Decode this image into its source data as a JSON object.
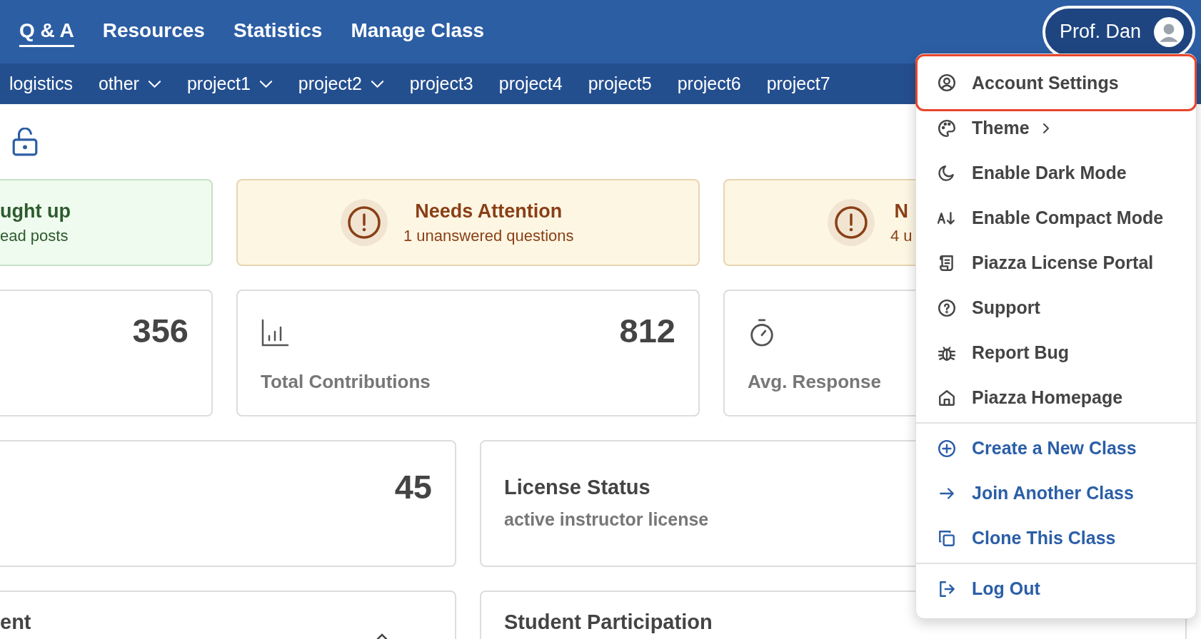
{
  "top_nav": {
    "tabs": [
      {
        "label": "Q & A",
        "selected": true
      },
      {
        "label": "Resources",
        "selected": false
      },
      {
        "label": "Statistics",
        "selected": false
      },
      {
        "label": "Manage Class",
        "selected": false
      }
    ],
    "user": {
      "name": "Prof. Dan"
    }
  },
  "category_bar": [
    {
      "label": "logistics",
      "dropdown": false
    },
    {
      "label": "other",
      "dropdown": true
    },
    {
      "label": "project1",
      "dropdown": true
    },
    {
      "label": "project2",
      "dropdown": true
    },
    {
      "label": "project3",
      "dropdown": false
    },
    {
      "label": "project4",
      "dropdown": false
    },
    {
      "label": "project5",
      "dropdown": false
    },
    {
      "label": "project6",
      "dropdown": false
    },
    {
      "label": "project7",
      "dropdown": false
    }
  ],
  "status_cards": [
    {
      "kind": "success",
      "title": "ught up",
      "subtitle": "ead posts"
    },
    {
      "kind": "warning",
      "title": "Needs Attention",
      "subtitle": "1 unanswered questions"
    },
    {
      "kind": "warning",
      "title": "N",
      "subtitle": "4 u"
    }
  ],
  "stat_cards": [
    {
      "value": "356"
    },
    {
      "value": "812",
      "label": "Total Contributions"
    },
    {
      "label": "Avg. Response"
    }
  ],
  "info_cards": [
    {
      "value": "45"
    },
    {
      "title": "License Status",
      "subtitle": "active instructor license"
    }
  ],
  "bottom_cards": [
    {
      "title": "ent"
    },
    {
      "title": "Student Participation"
    }
  ],
  "account_menu": {
    "groups": [
      [
        {
          "label": "Account Settings",
          "kind": "default",
          "highlighted": true,
          "submenu": false
        },
        {
          "label": "Theme",
          "kind": "default",
          "highlighted": false,
          "submenu": true
        },
        {
          "label": "Enable Dark Mode",
          "kind": "default",
          "highlighted": false,
          "submenu": false
        },
        {
          "label": "Enable Compact Mode",
          "kind": "default",
          "highlighted": false,
          "submenu": false
        },
        {
          "label": "Piazza License Portal",
          "kind": "default",
          "highlighted": false,
          "submenu": false
        },
        {
          "label": "Support",
          "kind": "default",
          "highlighted": false,
          "submenu": false
        },
        {
          "label": "Report Bug",
          "kind": "default",
          "highlighted": false,
          "submenu": false
        },
        {
          "label": "Piazza Homepage",
          "kind": "default",
          "highlighted": false,
          "submenu": false
        }
      ],
      [
        {
          "label": "Create a New Class",
          "kind": "accent",
          "highlighted": false,
          "submenu": false
        },
        {
          "label": "Join Another Class",
          "kind": "accent",
          "highlighted": false,
          "submenu": false
        },
        {
          "label": "Clone This Class",
          "kind": "accent",
          "highlighted": false,
          "submenu": false
        }
      ],
      [
        {
          "label": "Log Out",
          "kind": "accent",
          "highlighted": false,
          "submenu": false
        }
      ]
    ]
  }
}
